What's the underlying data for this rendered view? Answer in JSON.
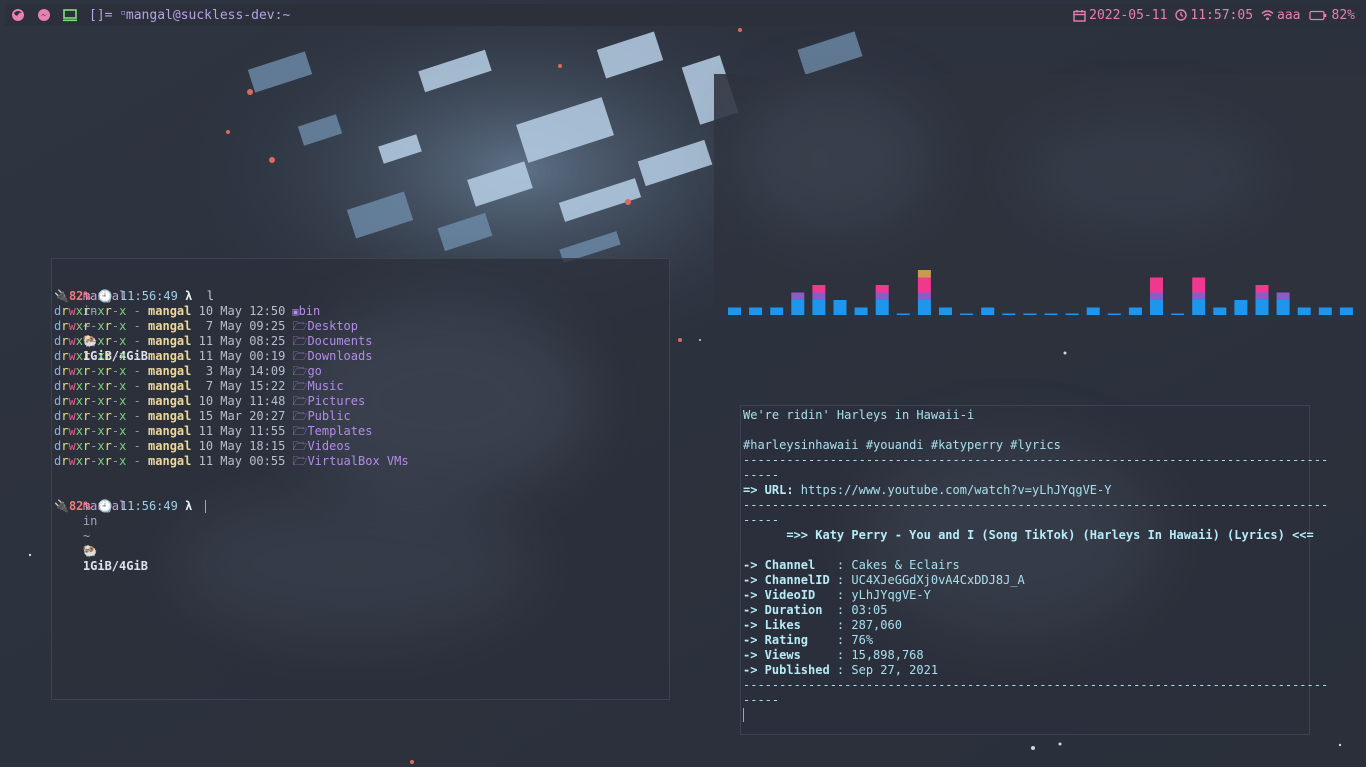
{
  "topbar": {
    "layout_symbol": "[]=",
    "window_title": "mangal@suckless-dev:~",
    "date": "2022-05-11",
    "time": "11:57:05",
    "wifi_name": "aaa",
    "battery": "82%",
    "icons": [
      "firefox-icon",
      "messenger-icon",
      "terminal-icon"
    ],
    "accent_color": "#e780b3"
  },
  "terminal1": {
    "prompt": {
      "user": "mangal",
      "in": "in",
      "dir": "~",
      "mem": "1GiB/4GiB",
      "battery": "82%",
      "time": "11:56:49",
      "lambda": "λ",
      "command": "l"
    },
    "listing": [
      {
        "perm": [
          "d",
          "r",
          "w",
          "x",
          "r",
          "-",
          "x",
          "r",
          "-",
          "x"
        ],
        "owner": "mangal",
        "date": "10 May 12:50",
        "icon": "",
        "name": "bin"
      },
      {
        "perm": [
          "d",
          "r",
          "w",
          "x",
          "r",
          "-",
          "x",
          "r",
          "-",
          "x"
        ],
        "owner": "mangal",
        "date": " 7 May 09:25",
        "icon": "🗁",
        "name": "Desktop"
      },
      {
        "perm": [
          "d",
          "r",
          "w",
          "x",
          "r",
          "-",
          "x",
          "r",
          "-",
          "x"
        ],
        "owner": "mangal",
        "date": "11 May 08:25",
        "icon": "🗁",
        "name": "Documents"
      },
      {
        "perm": [
          "d",
          "r",
          "w",
          "x",
          "r",
          "-",
          "x",
          "r",
          "-",
          "x"
        ],
        "owner": "mangal",
        "date": "11 May 00:19",
        "icon": "🗁",
        "name": "Downloads"
      },
      {
        "perm": [
          "d",
          "r",
          "w",
          "x",
          "r",
          "-",
          "x",
          "r",
          "-",
          "x"
        ],
        "owner": "mangal",
        "date": " 3 May 14:09",
        "icon": "🗁",
        "name": "go"
      },
      {
        "perm": [
          "d",
          "r",
          "w",
          "x",
          "r",
          "-",
          "x",
          "r",
          "-",
          "x"
        ],
        "owner": "mangal",
        "date": " 7 May 15:22",
        "icon": "🗁",
        "name": "Music"
      },
      {
        "perm": [
          "d",
          "r",
          "w",
          "x",
          "r",
          "-",
          "x",
          "r",
          "-",
          "x"
        ],
        "owner": "mangal",
        "date": "10 May 11:48",
        "icon": "🗁",
        "name": "Pictures"
      },
      {
        "perm": [
          "d",
          "r",
          "w",
          "x",
          "r",
          "-",
          "x",
          "r",
          "-",
          "x"
        ],
        "owner": "mangal",
        "date": "15 Mar 20:27",
        "icon": "🗁",
        "name": "Public"
      },
      {
        "perm": [
          "d",
          "r",
          "w",
          "x",
          "r",
          "-",
          "x",
          "r",
          "-",
          "x"
        ],
        "owner": "mangal",
        "date": "11 May 11:55",
        "icon": "🗁",
        "name": "Templates"
      },
      {
        "perm": [
          "d",
          "r",
          "w",
          "x",
          "r",
          "-",
          "x",
          "r",
          "-",
          "x"
        ],
        "owner": "mangal",
        "date": "10 May 18:15",
        "icon": "🗁",
        "name": "Videos"
      },
      {
        "perm": [
          "d",
          "r",
          "w",
          "x",
          "r",
          "-",
          "x",
          "r",
          "-",
          "x"
        ],
        "owner": "mangal",
        "date": "11 May 00:55",
        "icon": "🗁",
        "name": "VirtualBox VMs"
      }
    ],
    "prompt2": {
      "user": "mangal",
      "in": "in",
      "dir": "~",
      "mem": "1GiB/4GiB",
      "battery": "82%",
      "time": "11:56:49",
      "lambda": "λ"
    }
  },
  "visualizer": {
    "bar_levels": [
      1,
      1,
      1,
      3,
      4,
      2,
      1,
      4,
      0,
      6,
      1,
      0,
      1,
      0,
      0,
      0,
      0,
      1,
      0,
      1,
      5,
      0,
      5,
      1,
      2,
      4,
      3,
      1,
      1,
      1
    ],
    "colors": [
      "#1e96ee",
      "#1e96ee",
      "#8b5cc8",
      "#f0388f",
      "#f0388f",
      "#c79a4f"
    ]
  },
  "terminal2": {
    "lines": [
      {
        "text": "We're ridin' Harleys in Hawaii-i",
        "bold": false
      },
      {
        "text": "",
        "bold": false
      },
      {
        "text": "#harleysinhawaii #youandi #katyperry #lyrics",
        "bold": false
      },
      {
        "text": "---------------------------------------------------------------------------------",
        "bold": false
      },
      {
        "text": "-----",
        "bold": false
      },
      {
        "text": "=> URL:",
        "bold": true,
        "value": " https://www.youtube.com/watch?v=yLhJYqgVE-Y"
      },
      {
        "text": "---------------------------------------------------------------------------------",
        "bold": false
      },
      {
        "text": "-----",
        "bold": false
      },
      {
        "text": "      =>> Katy Perry - You and I (Song TikTok) (Harleys In Hawaii) (Lyrics) <<=",
        "bold": true
      },
      {
        "text": "",
        "bold": false
      },
      {
        "text": "-> Channel  ",
        "bold": true,
        "value": " : Cakes & Eclairs"
      },
      {
        "text": "-> ChannelID",
        "bold": true,
        "value": " : UC4XJeGGdXj0vA4CxDDJ8J_A"
      },
      {
        "text": "-> VideoID  ",
        "bold": true,
        "value": " : yLhJYqgVE-Y"
      },
      {
        "text": "-> Duration ",
        "bold": true,
        "value": " : 03:05"
      },
      {
        "text": "-> Likes    ",
        "bold": true,
        "value": " : 287,060"
      },
      {
        "text": "-> Rating   ",
        "bold": true,
        "value": " : 76%"
      },
      {
        "text": "-> Views    ",
        "bold": true,
        "value": " : 15,898,768"
      },
      {
        "text": "-> Published",
        "bold": true,
        "value": " : Sep 27, 2021"
      },
      {
        "text": "---------------------------------------------------------------------------------",
        "bold": false
      },
      {
        "text": "-----",
        "bold": false
      }
    ]
  }
}
